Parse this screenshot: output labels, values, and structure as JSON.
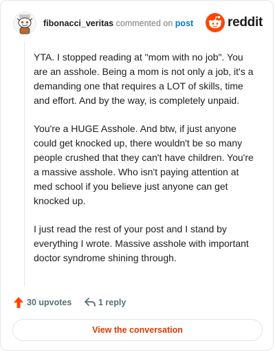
{
  "header": {
    "username": "fibonacci_veritas",
    "action_text": "commented on",
    "post_link": "post",
    "brand": "reddit"
  },
  "comment": {
    "paragraphs": [
      "YTA. I stopped reading at \"mom with no job\". You are an asshole. Being a mom is not only a job, it's a demanding one that requires a LOT of skills, time and effort. And by the way, is completely unpaid.",
      "You're a HUGE Asshole. And btw, if just anyone could get knocked up, there wouldn't be so many people crushed that they can't have children. You're a massive asshole. Who isn't paying attention at med school if you believe just anyone can get knocked up.",
      "I just read the rest of your post and I stand by everything I wrote. Massive asshole with important doctor syndrome shining through."
    ]
  },
  "actions": {
    "upvotes": "30 upvotes",
    "replies": "1 reply"
  },
  "cta": {
    "label": "View the conversation"
  },
  "colors": {
    "brand_orange": "#ff4500",
    "upvote": "#ff4500",
    "link_blue": "#0079d3",
    "cta_text": "#d93a00",
    "muted": "#576f76"
  },
  "icons": {
    "avatar": "snoo-avatar",
    "brand": "reddit-snoo-icon",
    "upvote": "upvote-arrow-icon",
    "reply": "reply-arrow-icon"
  }
}
